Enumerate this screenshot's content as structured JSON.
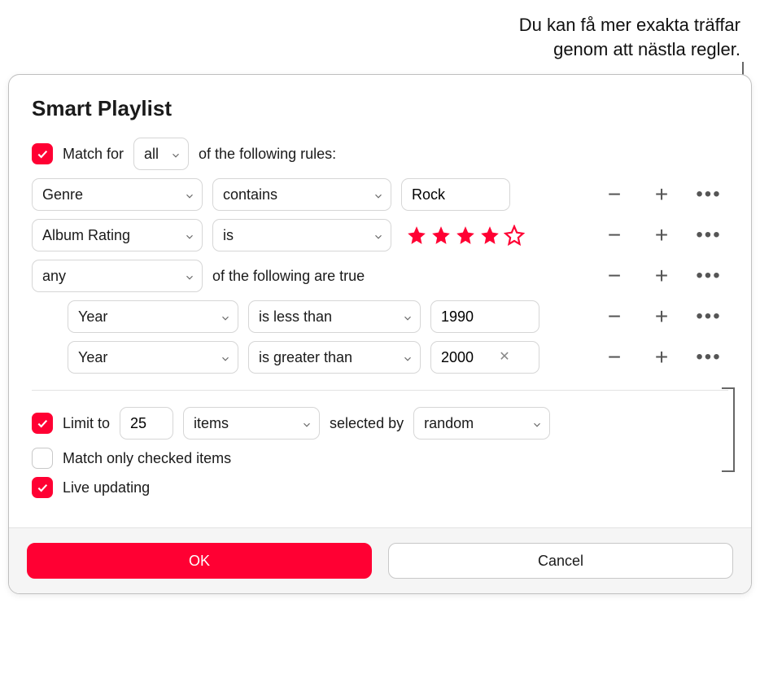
{
  "callout": {
    "line1": "Du kan få mer exakta träffar",
    "line2": "genom att nästla regler."
  },
  "title": "Smart Playlist",
  "match": {
    "checked": true,
    "prefix": "Match  for",
    "mode": "all",
    "suffix": "of the following rules:"
  },
  "rules": [
    {
      "field": "Genre",
      "op": "contains",
      "value": "Rock"
    },
    {
      "field": "Album Rating",
      "op": "is",
      "stars": 4,
      "of": 5
    },
    {
      "field": "any",
      "static": "of the following are true"
    }
  ],
  "nested": [
    {
      "field": "Year",
      "op": "is less than",
      "value": "1990",
      "clear": false
    },
    {
      "field": "Year",
      "op": "is greater than",
      "value": "2000",
      "clear": true
    }
  ],
  "limit": {
    "checked": true,
    "prefix": "Limit to",
    "count": "25",
    "unit": "items",
    "selected_by_label": "selected by",
    "selected_by": "random"
  },
  "match_only_checked": {
    "checked": false,
    "label": "Match only checked items"
  },
  "live_updating": {
    "checked": true,
    "label": "Live updating"
  },
  "buttons": {
    "ok": "OK",
    "cancel": "Cancel"
  },
  "accent": "#ff0033"
}
